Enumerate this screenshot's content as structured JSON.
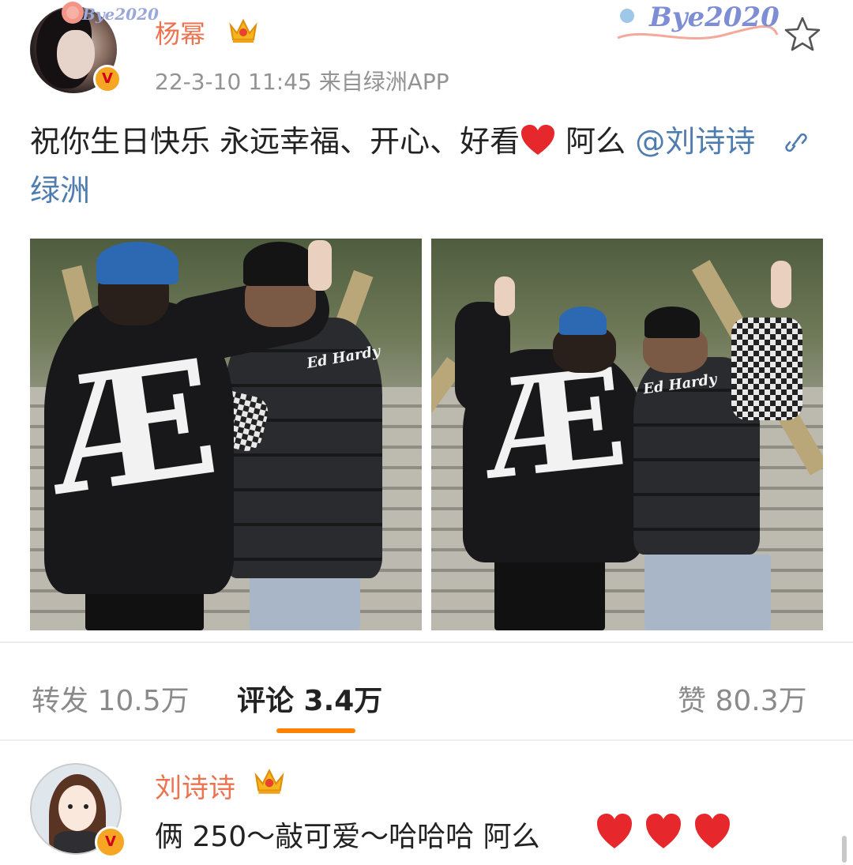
{
  "post": {
    "author": "杨幂",
    "meta": "22-3-10 11:45  来自绿洲APP",
    "text_main": "祝你生日快乐 永远幸福、开心、好看",
    "text_after_heart": " 阿么",
    "mention": "@刘诗诗",
    "link_text": "绿洲",
    "avatar_deco_text": "Bye2020",
    "top_deco_text": "Bye2020",
    "photos": [
      {
        "logo_text": "Ed Hardy"
      },
      {
        "logo_text": "Ed Hardy"
      }
    ]
  },
  "stats": {
    "repost_label": "转发 10.5万",
    "comment_label": "评论 3.4万",
    "like_label": "赞 80.3万"
  },
  "comment": {
    "author": "刘诗诗",
    "text": "俩 250～敲可爱～哈哈哈 阿么"
  },
  "icons": {
    "verify": "verified-v-icon",
    "crown": "crown-icon",
    "star": "star-outline-icon",
    "link": "link-icon",
    "heart": "heart-icon"
  },
  "colors": {
    "username": "#eb7350",
    "link": "#507daf",
    "tab_indicator": "#ff8200",
    "heart": "#e6282c"
  }
}
